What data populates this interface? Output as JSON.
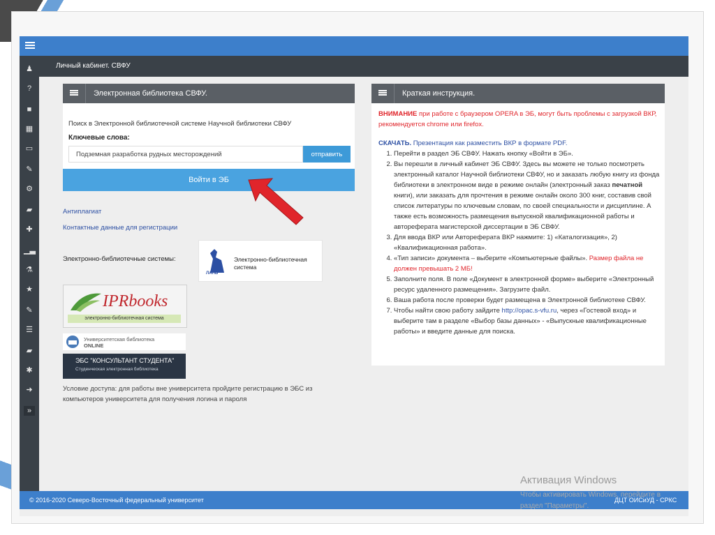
{
  "app": {
    "breadcrumb": "Личный кабинет. СВФУ",
    "footer_left": "© 2016-2020 Северо-Восточный федеральный университет",
    "footer_right": "ДЦТ ОИСиУД - СРКС"
  },
  "sidebar_icons": [
    "male-icon",
    "question-icon",
    "briefcase-icon",
    "table-icon",
    "id-card-icon",
    "edit-icon",
    "cogs-icon",
    "book-icon",
    "plus-icon",
    "chart-icon",
    "flask-icon",
    "star-icon",
    "edit-icon-2",
    "list-icon",
    "book-icon-2",
    "asterisk-icon",
    "sign-out-icon",
    "angle-double-right-icon"
  ],
  "left_panel": {
    "title": "Электронная библиотека СВФУ.",
    "intro": "Поиск в Электронной библиотечной системе Научной библиотеки СВФУ",
    "keywords_label": "Ключевые слова:",
    "search_value": "Подземная разработка рудных месторождений",
    "send_label": "отправить",
    "enter_label": "Войти в ЭБ",
    "link_antiplagiat": "Антиплагиат",
    "link_contacts": "Контактные данные для регистрации",
    "ebs_label": "Электронно-библиотечные системы:",
    "lan_name": "Электронно-библиотечная система",
    "lan_logo": "ЛАНЬ",
    "ipr_title": "IPRbooks",
    "ipr_sub": "электронно-библиотечная система",
    "ub_line1": "Университетская библиотека",
    "ub_line2": "ONLINE",
    "ks_line1": "ЭБС \"КОНСУЛЬТАНТ СТУДЕНТА\"",
    "ks_line2": "Студенческая электронная библиотека",
    "access": "Условие доступа: для работы вне университета пройдите регистрацию в ЭБС из компьютеров университета для получения логина и пароля"
  },
  "right_panel": {
    "title": "Краткая инструкция.",
    "warning_bold": "ВНИМАНИЕ",
    "warning_rest": " при работе с браузером OPERA в ЭБ, могут быть проблемы с загрузкой ВКР, рекомендуется chrome или firefox.",
    "download_label": "СКАЧАТЬ.",
    "download_rest": " Презентация как разместить ВКР в формате PDF.",
    "steps": [
      {
        "text": "Перейти в раздел ЭБ СВФУ. Нажать кнопку «Войти в ЭБ»."
      },
      {
        "pre": "Вы перешли в личный кабинет ЭБ СВФУ. Здесь вы можете не только посмотреть электронный каталог Научной библиотеки СВФУ, но и заказать любую книгу из фонда библиотеки в электронном виде в режиме онлайн (электронный заказ ",
        "bold": "печатной",
        "post": " книги), или заказать для прочтения в режиме онлайн около 300 книг, составив свой список литературы по ключевым словам, по своей специальности и дисциплине. А также есть возможность размещения выпускной квалификационной работы и автореферата магистерской диссертации в ЭБ СВФУ."
      },
      {
        "text": "Для ввода ВКР или Автореферата ВКР нажмите: 1) «Каталогизация», 2) «Квалификационная работа»."
      },
      {
        "pre": "«Тип записи» документа – выберите «Компьютерные файлы».",
        "red": " Размер файла не должен превышать 2 МБ!"
      },
      {
        "text": "Заполните поля. В поле «Документ в электронной форме» выберите «Электронный ресурс удаленного размещения». Загрузите файл."
      },
      {
        "text": "Ваша работа после проверки будет размещена в Электронной библиотеке СВФУ."
      },
      {
        "pre": "Чтобы найти свою работу зайдите ",
        "link": "http://opac.s-vfu.ru",
        "post": ", через «Гостевой вход» и выберите там в разделе «Выбор базы данных» - «Выпускные квалификационные работы» и введите данные для поиска."
      }
    ]
  },
  "watermark": {
    "title": "Активация Windows",
    "line1": "Чтобы активировать Windows, перейдите в",
    "line2": "раздел \"Параметры\"."
  },
  "colors": {
    "accent": "#3d7fcb",
    "sidebar": "#3a4148",
    "warning": "#e0252b",
    "arrow": "#e0252b"
  }
}
